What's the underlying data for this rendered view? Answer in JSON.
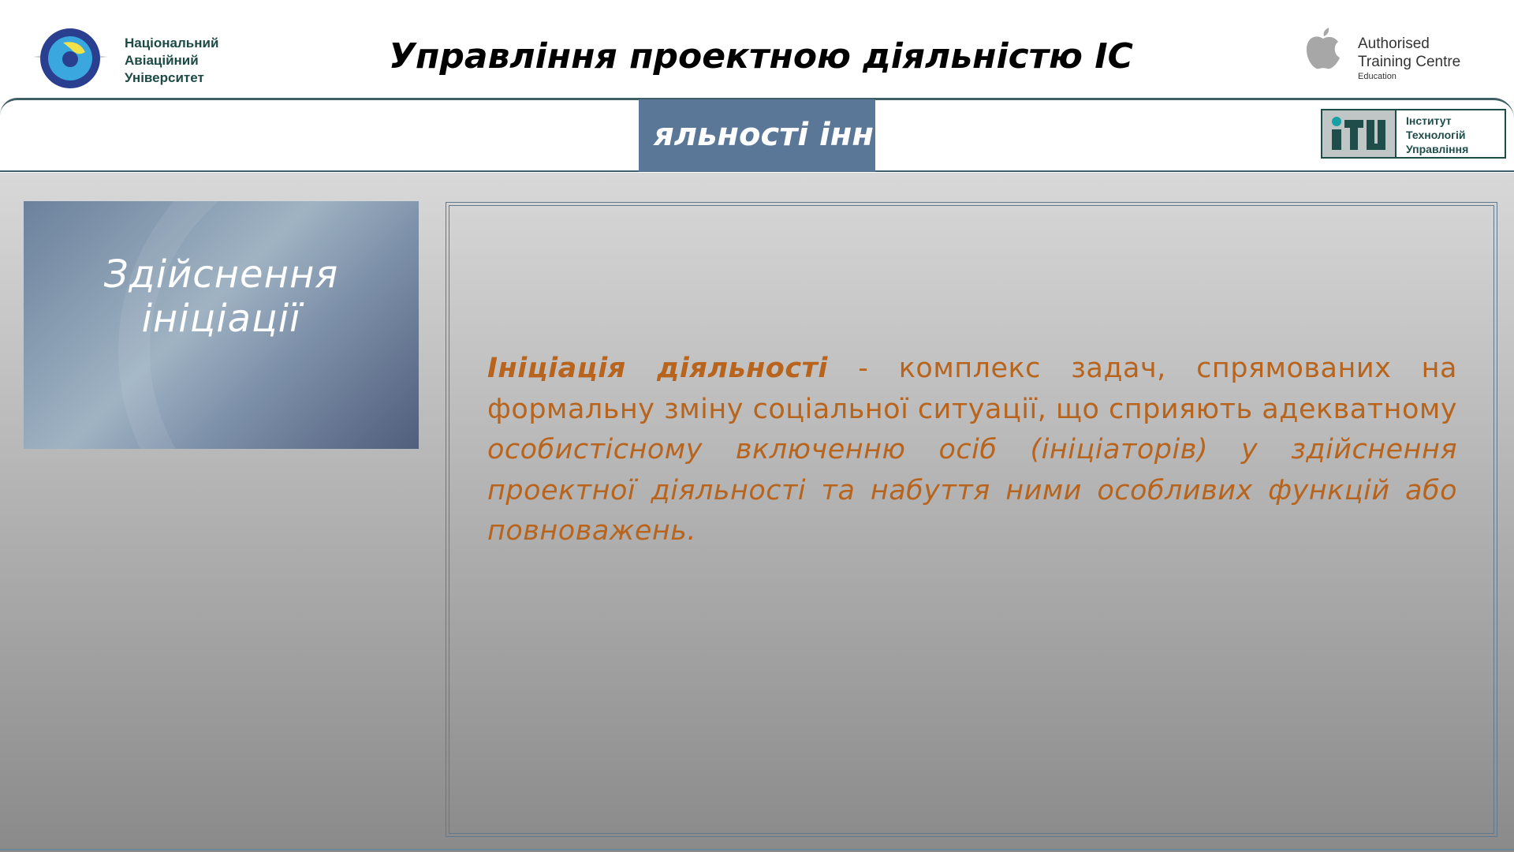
{
  "header": {
    "university": [
      "Національний",
      "Авіаційний",
      "Університет"
    ],
    "title": "Управління проектною діяльністю ІС",
    "partner": {
      "line1": "Authorised",
      "line2": "Training Centre",
      "line3": "Education"
    },
    "institute": [
      "Інститут",
      "Технологій",
      "Управління"
    ]
  },
  "band": {
    "visible_text": "яльності інн"
  },
  "sidebar": {
    "title_line1": "Здійснення",
    "title_line2": "ініціації"
  },
  "definition": {
    "term": "Ініціація діяльності",
    "plain": " - комплекс задач, спрямованих на формальну зміну соціальної ситуації, що сприяють адекватному ",
    "italic": "особистісному включенню осіб (ініціаторів) у здійснення проектної діяльності та набуття ними особливих функцій або повноважень."
  },
  "colors": {
    "accent": "#b8641c",
    "band": "#5a7797",
    "dark_teal": "#1f4e4a"
  }
}
